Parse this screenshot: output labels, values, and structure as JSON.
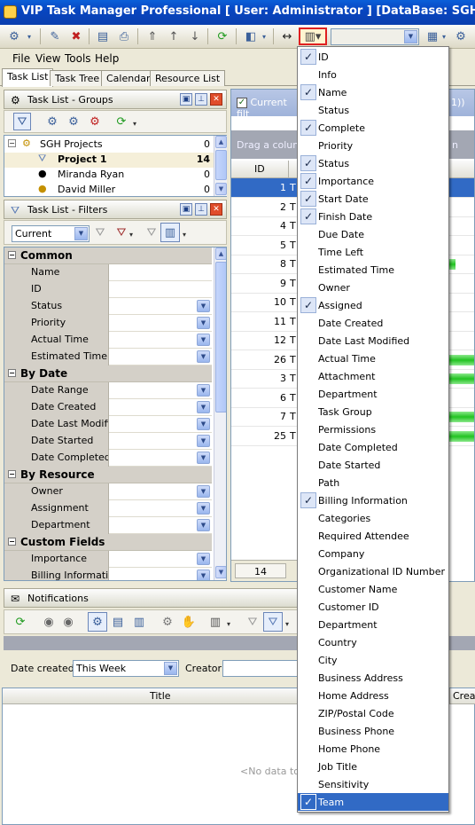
{
  "window": {
    "title": "VIP Task Manager Professional [ User: Administrator ] [DataBase: SGH Projects]"
  },
  "menubar": {
    "items": [
      "File",
      "View",
      "Tools",
      "Help"
    ]
  },
  "tabs": [
    "Task List",
    "Task Tree",
    "Calendar",
    "Resource List"
  ],
  "groups_panel": {
    "title": "Task List - Groups",
    "tree": [
      {
        "label": "SGH Projects",
        "count": "0",
        "level": 0,
        "icon": "database-icon"
      },
      {
        "label": "Project 1",
        "count": "14",
        "level": 1,
        "bold": true,
        "icon": "filter-icon"
      },
      {
        "label": "Miranda Ryan",
        "count": "0",
        "level": 1,
        "icon": "user-icon"
      },
      {
        "label": "David Miller",
        "count": "0",
        "level": 1,
        "icon": "user-icon"
      }
    ]
  },
  "filters_panel": {
    "title": "Task List - Filters",
    "filter_select": "Current",
    "categories": [
      {
        "name": "Common",
        "rows": [
          {
            "label": "Name",
            "dropdown": false
          },
          {
            "label": "ID",
            "dropdown": false
          },
          {
            "label": "Status",
            "dropdown": true
          },
          {
            "label": "Priority",
            "dropdown": true
          },
          {
            "label": "Actual Time",
            "dropdown": true
          },
          {
            "label": "Estimated Time",
            "dropdown": true
          }
        ]
      },
      {
        "name": "By Date",
        "rows": [
          {
            "label": "Date Range",
            "dropdown": true
          },
          {
            "label": "Date Created",
            "dropdown": true
          },
          {
            "label": "Date Last Modifi",
            "dropdown": true
          },
          {
            "label": "Date Started",
            "dropdown": true
          },
          {
            "label": "Date Completed",
            "dropdown": true
          }
        ]
      },
      {
        "name": "By Resource",
        "rows": [
          {
            "label": "Owner",
            "dropdown": true
          },
          {
            "label": "Assignment",
            "dropdown": true
          },
          {
            "label": "Department",
            "dropdown": true
          }
        ]
      },
      {
        "name": "Custom Fields",
        "rows": [
          {
            "label": "Importance",
            "dropdown": true
          },
          {
            "label": "Billing Informatio",
            "dropdown": true
          }
        ]
      }
    ]
  },
  "task_grid": {
    "filter_label": "Current filt",
    "filter_suffix": "1))",
    "group_hint": "Drag a column",
    "group_hint_suffix": "n",
    "id_header": "ID",
    "rows": [
      {
        "id": "1",
        "title": "T",
        "selected": true,
        "bar": false
      },
      {
        "id": "2",
        "title": "T",
        "bar": false
      },
      {
        "id": "4",
        "title": "T",
        "bar": false
      },
      {
        "id": "5",
        "title": "T",
        "bar": false
      },
      {
        "id": "8",
        "title": "T",
        "bar": true
      },
      {
        "id": "9",
        "title": "T",
        "bar": false
      },
      {
        "id": "10",
        "title": "T",
        "bar": false
      },
      {
        "id": "11",
        "title": "T",
        "bar": false
      },
      {
        "id": "12",
        "title": "T",
        "bar": false
      },
      {
        "id": "26",
        "title": "T",
        "bar": true
      },
      {
        "id": "3",
        "title": "T",
        "bar": true
      },
      {
        "id": "6",
        "title": "T",
        "bar": false
      },
      {
        "id": "7",
        "title": "T",
        "bar": true
      },
      {
        "id": "25",
        "title": "T",
        "bar": true
      }
    ],
    "footer_count": "14"
  },
  "column_menu": {
    "items": [
      {
        "label": "ID",
        "checked": true
      },
      {
        "label": "Info",
        "checked": false
      },
      {
        "label": "Name",
        "checked": true
      },
      {
        "label": "Status",
        "checked": false
      },
      {
        "label": "Complete",
        "checked": true
      },
      {
        "label": "Priority",
        "checked": false
      },
      {
        "label": "Status",
        "checked": true
      },
      {
        "label": "Importance",
        "checked": true
      },
      {
        "label": "Start Date",
        "checked": true
      },
      {
        "label": "Finish Date",
        "checked": true
      },
      {
        "label": "Due Date",
        "checked": false
      },
      {
        "label": "Time Left",
        "checked": false
      },
      {
        "label": "Estimated Time",
        "checked": false
      },
      {
        "label": "Owner",
        "checked": false
      },
      {
        "label": "Assigned",
        "checked": true
      },
      {
        "label": "Date Created",
        "checked": false
      },
      {
        "label": "Date Last Modified",
        "checked": false
      },
      {
        "label": "Actual Time",
        "checked": false
      },
      {
        "label": "Attachment",
        "checked": false
      },
      {
        "label": "Department",
        "checked": false
      },
      {
        "label": "Task Group",
        "checked": false
      },
      {
        "label": "Permissions",
        "checked": false
      },
      {
        "label": "Date Completed",
        "checked": false
      },
      {
        "label": "Date Started",
        "checked": false
      },
      {
        "label": "Path",
        "checked": false
      },
      {
        "label": "Billing Information",
        "checked": true
      },
      {
        "label": "Categories",
        "checked": false
      },
      {
        "label": "Required Attendee",
        "checked": false
      },
      {
        "label": "Company",
        "checked": false
      },
      {
        "label": "Organizational ID Number",
        "checked": false
      },
      {
        "label": "Customer Name",
        "checked": false
      },
      {
        "label": "Customer ID",
        "checked": false
      },
      {
        "label": "Department",
        "checked": false
      },
      {
        "label": "Country",
        "checked": false
      },
      {
        "label": "City",
        "checked": false
      },
      {
        "label": "Business Address",
        "checked": false
      },
      {
        "label": "Home Address",
        "checked": false
      },
      {
        "label": "ZIP/Postal Code",
        "checked": false
      },
      {
        "label": "Business Phone",
        "checked": false
      },
      {
        "label": "Home Phone",
        "checked": false
      },
      {
        "label": "Job Title",
        "checked": false
      },
      {
        "label": "Sensitivity",
        "checked": false
      },
      {
        "label": "Team",
        "checked": true,
        "highlighted": true
      }
    ]
  },
  "notifications": {
    "title": "Notifications",
    "date_created_label": "Date created:",
    "date_created_value": "This Week",
    "creator_label": "Creator:",
    "col_title": "Title",
    "col_creat": "Creat",
    "empty_text": "<No data to d"
  },
  "colors": {
    "selection": "#316ac5",
    "progress": "#22c322",
    "titlebar": "#0a4fc8"
  }
}
